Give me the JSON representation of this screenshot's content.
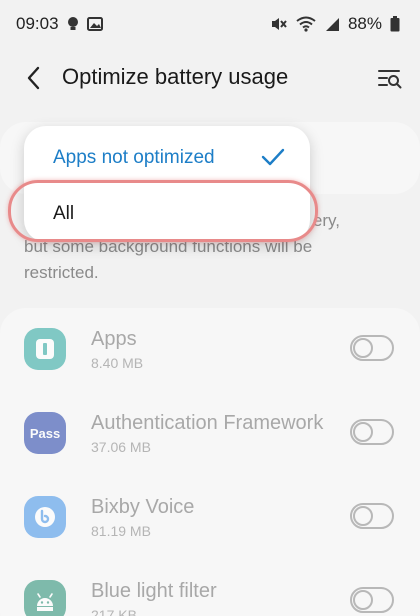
{
  "status_bar": {
    "time": "09:03",
    "battery": "88%"
  },
  "header": {
    "title": "Optimize battery usage"
  },
  "filter_menu": {
    "selected_label": "Apps not optimized",
    "other_label": "All"
  },
  "description": {
    "line1_visible_tail": "ery,",
    "line2": "but some background functions will be",
    "line3": "restricted."
  },
  "apps": [
    {
      "name": "Apps",
      "size": "8.40 MB",
      "icon": "apps-app-icon",
      "icon_color": "#1fa39b",
      "optimized": false
    },
    {
      "name": "Authentication Framework",
      "size": "37.06 MB",
      "icon": "pass-app-icon",
      "icon_color": "#1b3aa6",
      "icon_text": "Pass",
      "optimized": false
    },
    {
      "name": "Bixby Voice",
      "size": "81.19 MB",
      "icon": "bixby-app-icon",
      "icon_color": "#3a8ee8",
      "optimized": false
    },
    {
      "name": "Blue light filter",
      "size": "217 KB",
      "icon": "android-app-icon",
      "icon_color": "#1c8a6e",
      "optimized": false
    }
  ],
  "colors": {
    "accent": "#1d7ec7",
    "highlight": "#e88a8a"
  }
}
